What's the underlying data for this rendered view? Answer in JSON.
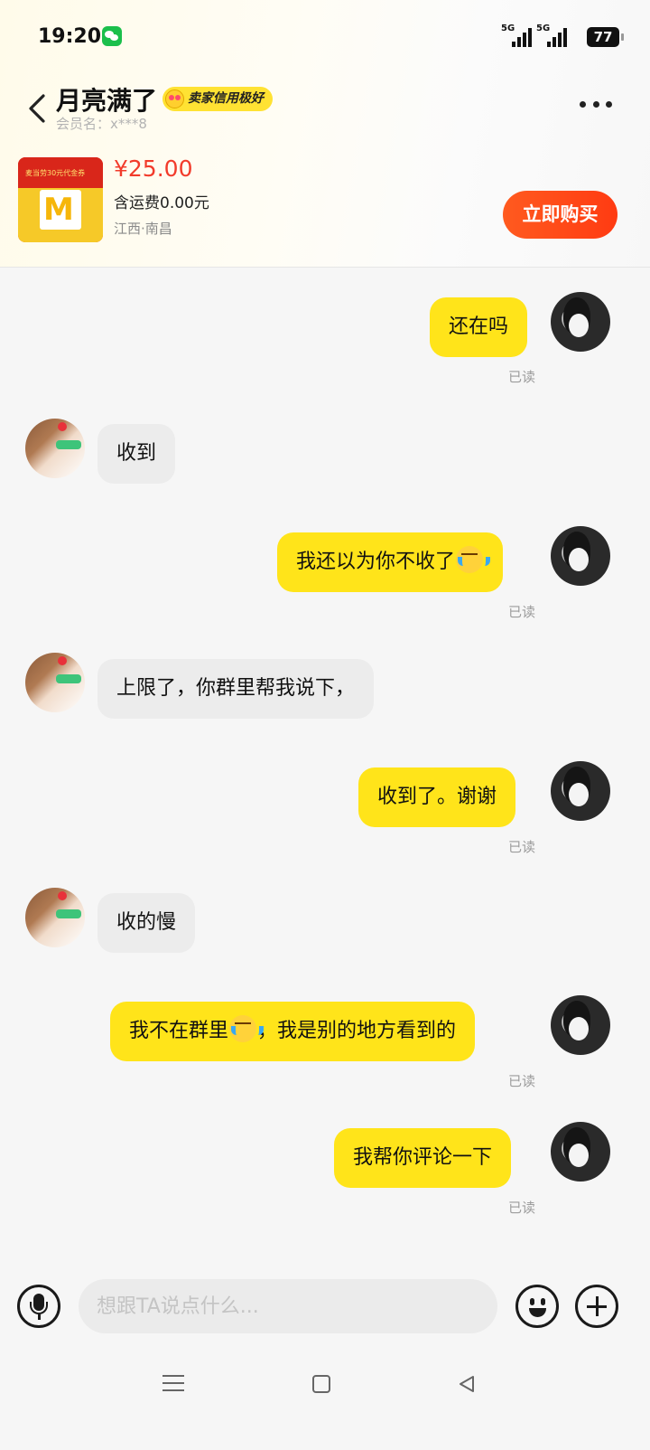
{
  "status_bar": {
    "time": "19:20",
    "signal_1": "5G",
    "signal_2": "5G",
    "battery": "77",
    "notification_icon": "wechat-icon"
  },
  "header": {
    "seller_name": "月亮满了",
    "credit_badge": "卖家信用极好",
    "member_id": "会员名：x***8",
    "back_icon": "chevron-left-icon",
    "more_icon": "more-dots-icon"
  },
  "product": {
    "thumb_text": "麦当劳30元代金券",
    "thumb_logo": "M",
    "price": "¥25.00",
    "shipping": "含运费0.00元",
    "location": "江西·南昌",
    "buy_label": "立即购买"
  },
  "messages": [
    {
      "from": "me",
      "text": "还在吗",
      "read": "已读"
    },
    {
      "from": "them",
      "text": "收到"
    },
    {
      "from": "me",
      "text_before": "我还以为你不收了",
      "emoji": "crying-face",
      "read": "已读"
    },
    {
      "from": "them",
      "text": "上限了，你群里帮我说下，"
    },
    {
      "from": "me",
      "text": "收到了。谢谢",
      "read": "已读"
    },
    {
      "from": "them",
      "text": "收的慢"
    },
    {
      "from": "me",
      "text_before": "我不在群里",
      "emoji": "crying-face",
      "text_after": "，我是别的地方看到的",
      "read": "已读"
    },
    {
      "from": "me",
      "text": "我帮你评论一下",
      "read": "已读"
    }
  ],
  "input_bar": {
    "placeholder": "想跟TA说点什么...",
    "value": ""
  },
  "colors": {
    "accent_yellow": "#ffe41a",
    "price_red": "#f23b2b",
    "buy_orange": "#ff4a16"
  }
}
